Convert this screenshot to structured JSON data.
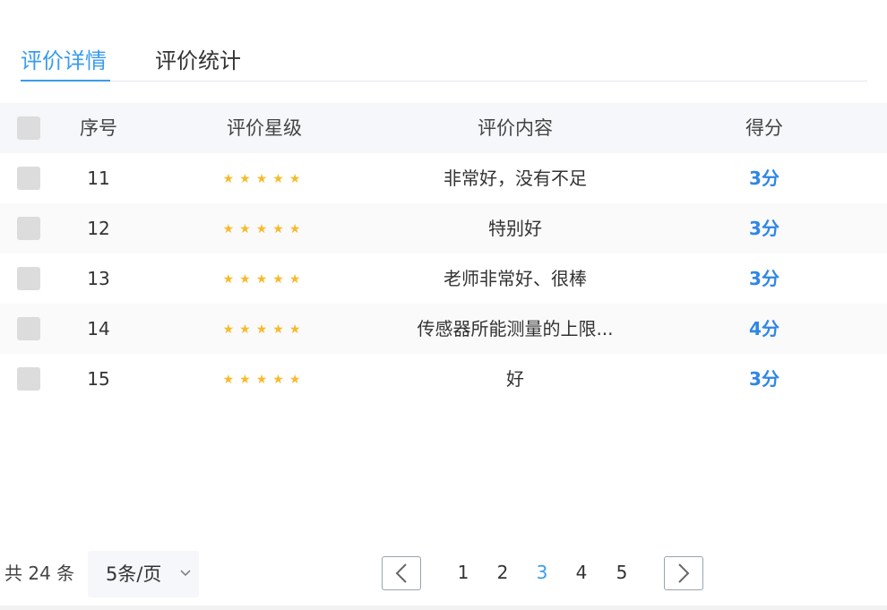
{
  "tabs": [
    {
      "label": "评价详情",
      "active": true
    },
    {
      "label": "评价统计",
      "active": false
    }
  ],
  "table": {
    "headers": {
      "index": "序号",
      "stars": "评价星级",
      "content": "评价内容",
      "score": "得分"
    },
    "rows": [
      {
        "index": "11",
        "stars": 5,
        "content": "非常好，没有不足",
        "score": "3分"
      },
      {
        "index": "12",
        "stars": 5,
        "content": "特别好",
        "score": "3分"
      },
      {
        "index": "13",
        "stars": 5,
        "content": "老师非常好、很棒",
        "score": "3分"
      },
      {
        "index": "14",
        "stars": 5,
        "content": "传感器所能测量的上限...",
        "score": "4分"
      },
      {
        "index": "15",
        "stars": 5,
        "content": "好",
        "score": "3分"
      }
    ]
  },
  "pagination": {
    "total_text": "共 24 条",
    "page_size": "5条/页",
    "pages": [
      "1",
      "2",
      "3",
      "4",
      "5"
    ],
    "current_page": "3"
  },
  "colors": {
    "accent": "#3a9cec",
    "score": "#2f86e6",
    "star": "#f7ba2a",
    "header_bg": "#f5f7fa"
  },
  "icons": {
    "prev": "chevron-left-icon",
    "next": "chevron-right-icon",
    "dropdown": "chevron-down-icon",
    "star": "star-icon"
  }
}
